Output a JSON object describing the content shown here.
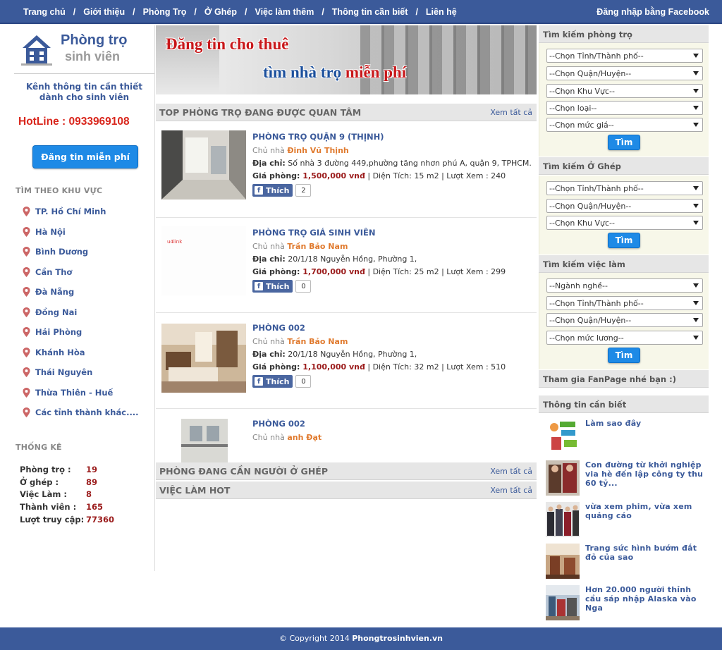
{
  "nav": {
    "items": [
      "Trang chủ",
      "Giới thiệu",
      "Phòng Trọ",
      "Ở Ghép",
      "Việc làm thêm",
      "Thông tin cần biết",
      "Liên hệ"
    ],
    "facebook_login": "Đăng nhập bằng Facebook"
  },
  "logo": {
    "line1": "Phòng trọ",
    "line2": "sinh viên"
  },
  "sidebar": {
    "tagline_1": "Kênh thông tin cần thiết",
    "tagline_2": "dành cho sinh viên",
    "hotline": "HotLine : 0933969108",
    "post_button": "Đăng tin miễn phí",
    "area_title": "TÌM THEO KHU VỰC",
    "areas": [
      "TP. Hồ Chí Minh",
      "Hà Nội",
      "Bình Dương",
      "Cần Thơ",
      "Đà Nẵng",
      "Đồng Nai",
      "Hải Phòng",
      "Khánh Hòa",
      "Thái Nguyên",
      "Thừa Thiên - Huế",
      "Các tỉnh thành khác...."
    ],
    "stats_title": "THỐNG KÊ",
    "stats": [
      {
        "label": "Phòng trọ :",
        "value": "19"
      },
      {
        "label": "Ở ghép :",
        "value": "89"
      },
      {
        "label": "Việc Làm :",
        "value": "8"
      },
      {
        "label": "Thành viên :",
        "value": "165"
      },
      {
        "label": "Lượt truy cập:",
        "value": "77360"
      }
    ]
  },
  "banner": {
    "line1": "Đăng tin cho thuê",
    "line2": "tìm nhà trọ ",
    "line2_highlight": "miễn phí"
  },
  "top_section": {
    "title": "TOP PHÒNG TRỌ ĐANG ĐƯỢC QUAN TÂM",
    "see_all": "Xem tất cả"
  },
  "listings": [
    {
      "title": "PHÒNG TRỌ QUẬN 9 (THỊNH)",
      "owner_label": "Chủ nhà ",
      "owner": "Đinh Vũ Thịnh",
      "address_label": "Địa chỉ:",
      "address": " Số nhà 3 đường 449,phường tăng nhơn phú A, quận 9, TPHCM.",
      "price_label": "Giá phòng: ",
      "price": "1,500,000 vnđ",
      "area_label": " | Diện Tích: ",
      "area": "15 m2",
      "views_label": " | Lượt Xem : ",
      "views": "240",
      "like_label": "Thích",
      "likes": "2"
    },
    {
      "title": "PHÒNG TRỌ GIÁ SINH VIÊN",
      "owner_label": "Chủ nhà ",
      "owner": "Trần Bảo Nam",
      "address_label": "Địa chỉ:",
      "address": " 20/1/18 Nguyễn Hồng, Phường 1,",
      "price_label": "Giá phòng: ",
      "price": "1,700,000 vnđ",
      "area_label": " | Diện Tích: ",
      "area": "25 m2",
      "views_label": " | Lượt Xem : ",
      "views": "299",
      "like_label": "Thích",
      "likes": "0"
    },
    {
      "title": "PHÒNG 002",
      "owner_label": "Chủ nhà ",
      "owner": "Trần Bảo Nam",
      "address_label": "Địa chỉ:",
      "address": " 20/1/18 Nguyễn Hồng, Phường 1,",
      "price_label": "Giá phòng: ",
      "price": "1,100,000 vnđ",
      "area_label": " | Diện Tích: ",
      "area": "32 m2",
      "views_label": " | Lượt Xem : ",
      "views": "510",
      "like_label": "Thích",
      "likes": "0"
    },
    {
      "title": "PHÒNG 002",
      "owner_label": "Chủ nhà ",
      "owner": "anh Đạt"
    }
  ],
  "roommate_section": {
    "title": "PHÒNG ĐANG CẦN NGƯỜI Ở GHÉP",
    "see_all": "Xem tất cả"
  },
  "jobs_section": {
    "title": "VIỆC LÀM HOT",
    "see_all": "Xem tất cả"
  },
  "search_room": {
    "title": "Tìm kiếm phòng trọ",
    "selects": [
      "--Chọn Tỉnh/Thành phố--",
      "--Chọn Quận/Huyện--",
      "--Chọn Khu Vực--",
      "--Chọn loại--",
      "--Chọn mức giá--"
    ],
    "button": "Tìm"
  },
  "search_roommate": {
    "title": "Tìm kiếm Ở Ghép",
    "selects": [
      "--Chọn Tỉnh/Thành phố--",
      "--Chọn Quận/Huyện--",
      "--Chọn Khu Vực--"
    ],
    "button": "Tìm"
  },
  "search_job": {
    "title": "Tìm kiếm việc làm",
    "selects": [
      "--Ngành nghề--",
      "--Chọn Tỉnh/Thành phố--",
      "--Chọn Quận/Huyện--",
      "--Chọn mức lương--"
    ],
    "button": "Tìm"
  },
  "fanpage": {
    "title": "Tham gia FanPage nhé bạn :)"
  },
  "news": {
    "title": "Thông tin cần biết",
    "items": [
      "Làm sao đây",
      "Con đường từ khởi nghiệp via hè đến lập công ty thu 60 tỷ...",
      "vừa xem phim, vừa xem quảng cáo",
      "Trang sức hình bướm đắt đỏ của sao",
      "Hơn 20.000 người thỉnh cầu sáp nhập Alaska vào Nga"
    ]
  },
  "footer": {
    "copyright": "© Copyright 2014 ",
    "site": "Phongtrosinhvien.vn"
  },
  "colors": {
    "brand_blue": "#3b5a9a",
    "hotline_red": "#d9261c",
    "price_red": "#9b1c1c",
    "owner_orange": "#e07a2e",
    "button_blue": "#1e8ae6"
  }
}
